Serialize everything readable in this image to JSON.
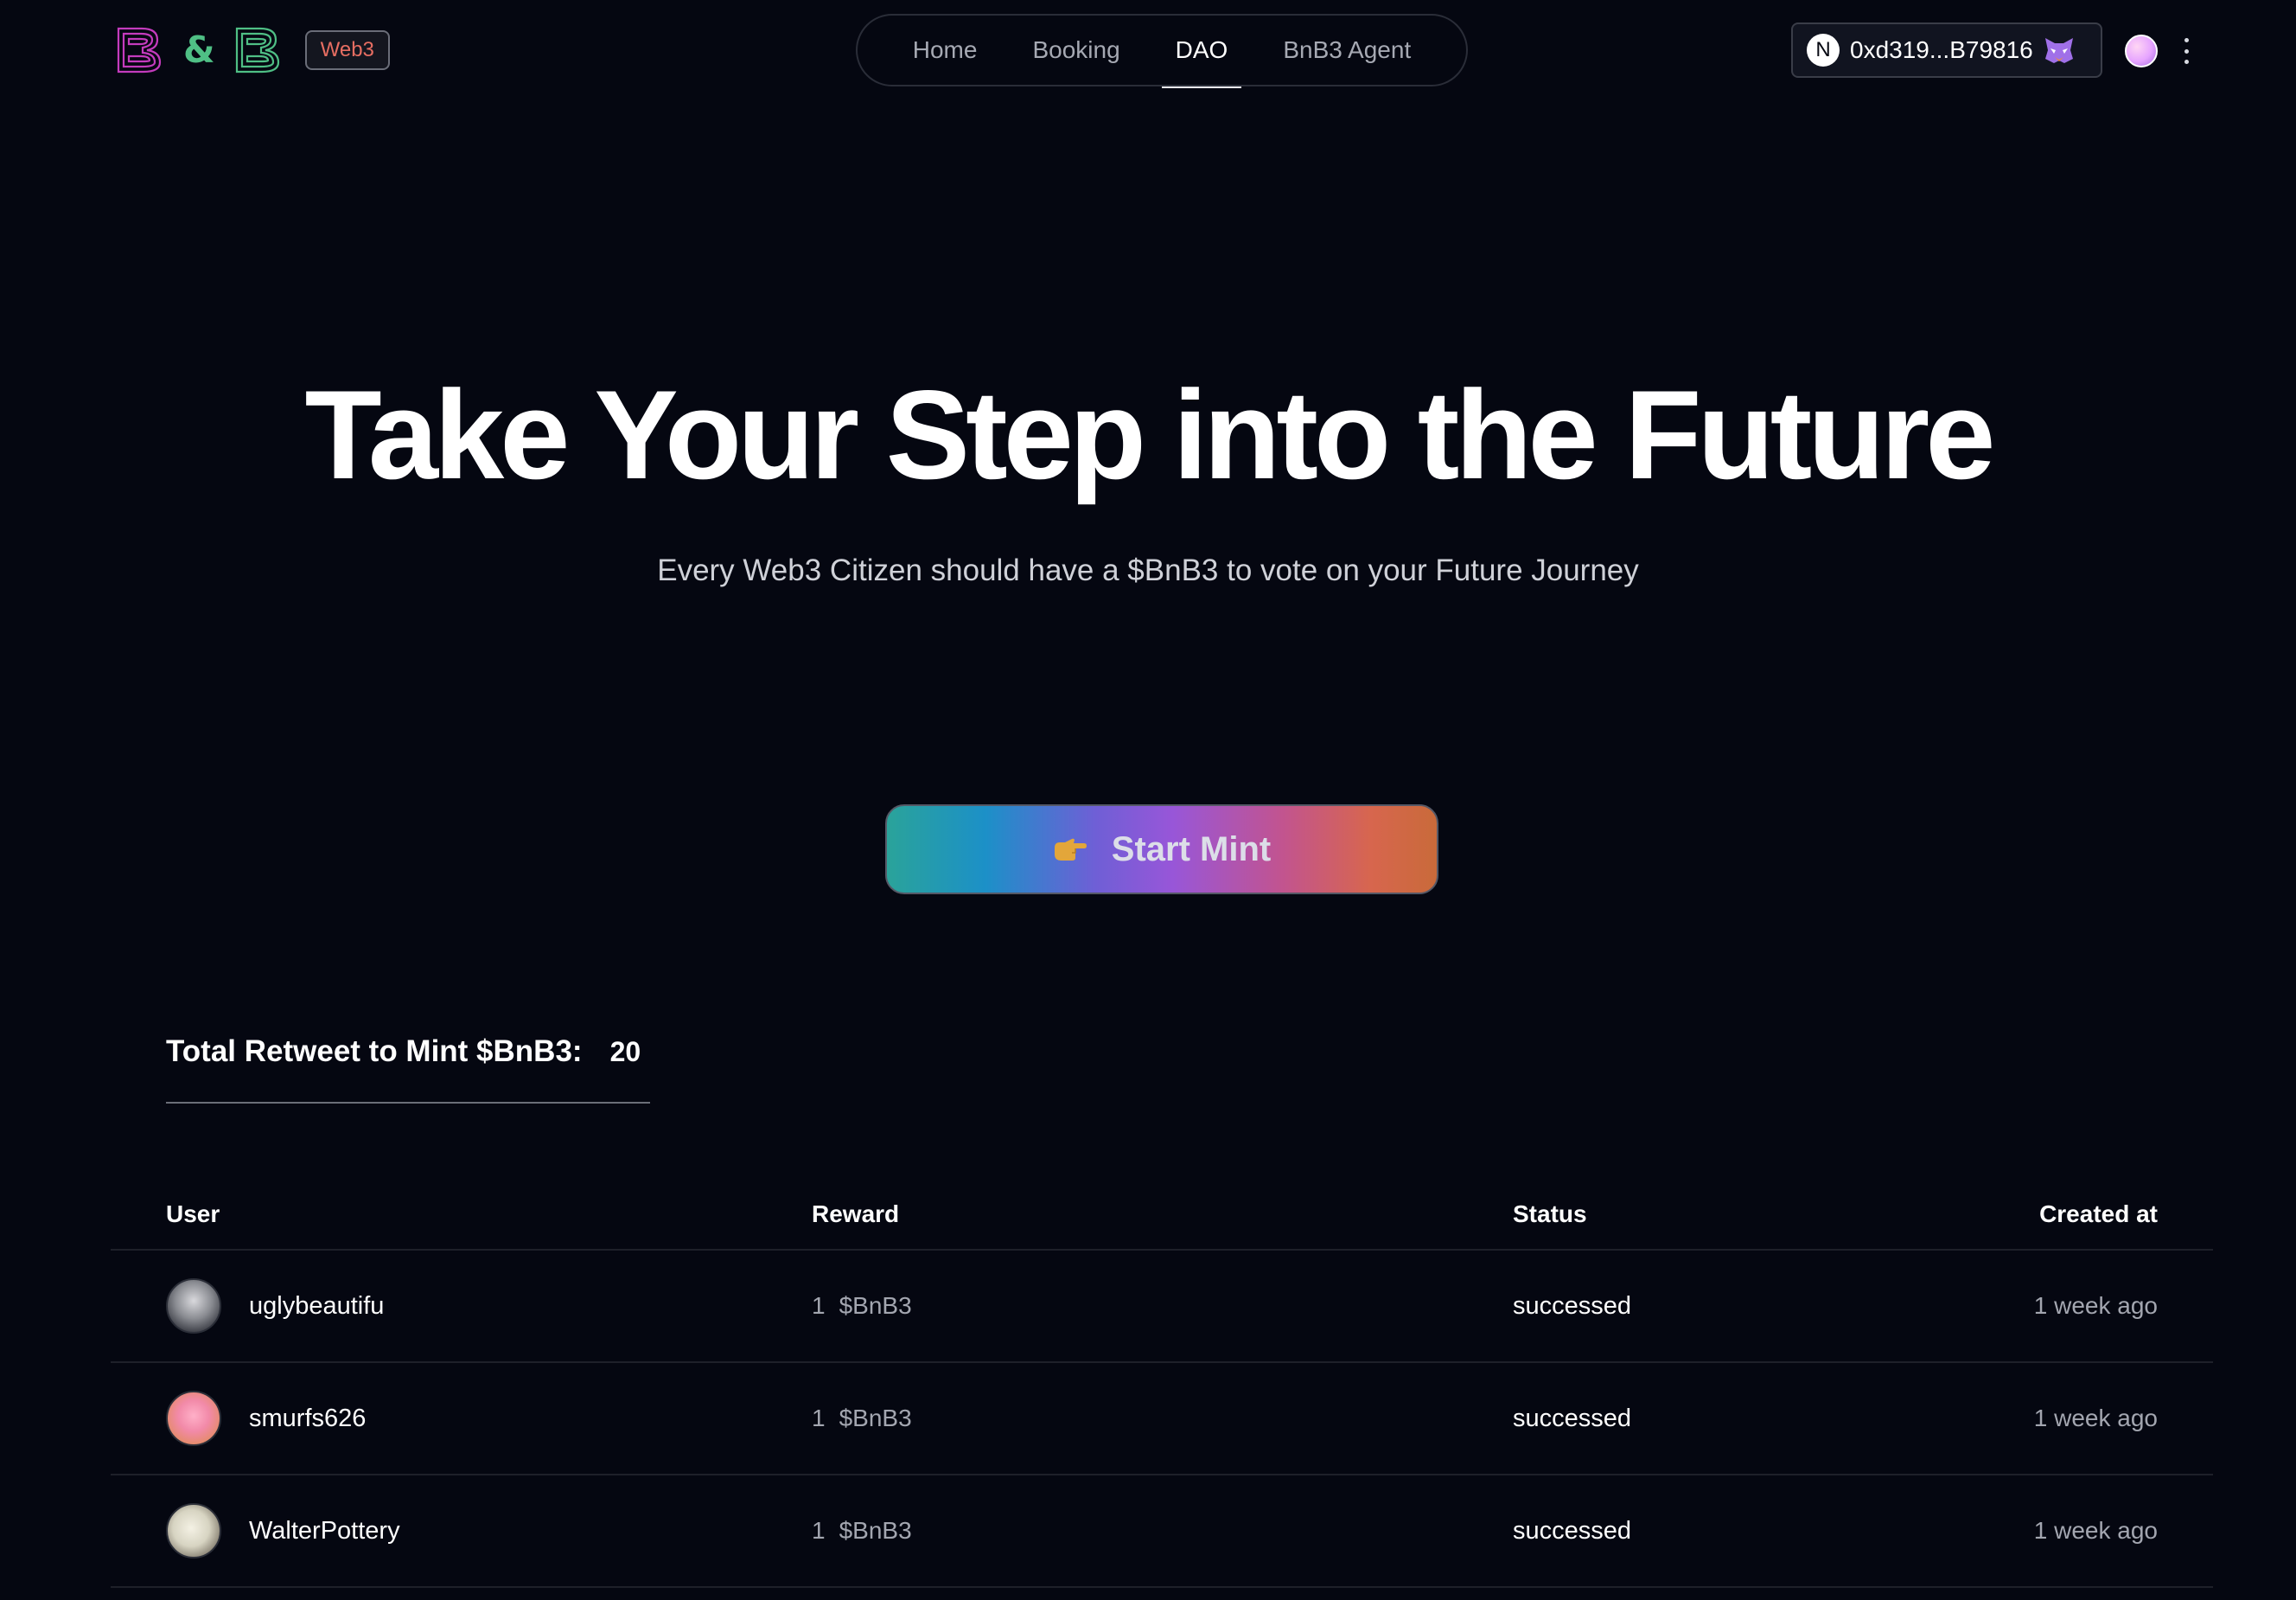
{
  "header": {
    "logo_amp": "&",
    "badge": "Web3",
    "nav": [
      {
        "label": "Home",
        "active": false
      },
      {
        "label": "Booking",
        "active": false
      },
      {
        "label": "DAO",
        "active": true
      },
      {
        "label": "BnB3 Agent",
        "active": false
      }
    ],
    "wallet": {
      "network_letter": "N",
      "address": "0xd319...B79816",
      "icon": "metamask-fox-icon"
    },
    "profile_icon": "avatar-icon",
    "more_icon": "vertical-ellipsis-icon"
  },
  "hero": {
    "title": "Take Your Step into the Future",
    "subtitle": "Every Web3 Citizen should have a $BnB3 to vote on your Future Journey"
  },
  "mint": {
    "label": "Start Mint",
    "icon": "pointing-hand-icon"
  },
  "total": {
    "label": "Total Retweet to Mint $BnB3:",
    "value": "20"
  },
  "table": {
    "columns": {
      "user": "User",
      "reward": "Reward",
      "status": "Status",
      "created": "Created at"
    },
    "rows": [
      {
        "user": "uglybeautifu",
        "reward": "1",
        "unit": "$BnB3",
        "status": "successed",
        "created": "1 week ago"
      },
      {
        "user": "smurfs626",
        "reward": "1",
        "unit": "$BnB3",
        "status": "successed",
        "created": "1 week ago"
      },
      {
        "user": "WalterPottery",
        "reward": "1",
        "unit": "$BnB3",
        "status": "successed",
        "created": "1 week ago"
      }
    ]
  },
  "colors": {
    "background": "#050711",
    "badge_text": "#e76e62",
    "logo_pink": "#c43bbd",
    "logo_green": "#4fbf85"
  }
}
